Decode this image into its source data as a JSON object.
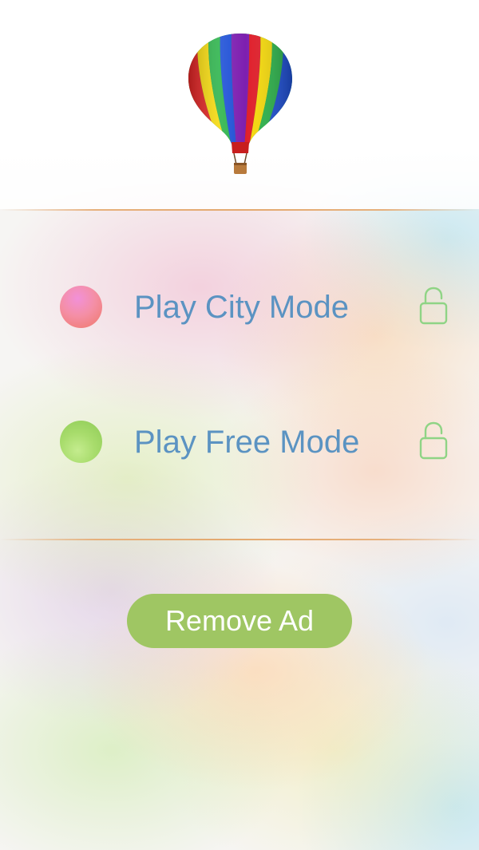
{
  "header": {
    "logo_icon": "hot-air-balloon-icon"
  },
  "modes": [
    {
      "label": "Play City Mode",
      "dot_color": "#f08a8c",
      "lock_icon": "unlocked-padlock-icon"
    },
    {
      "label": "Play Free Mode",
      "dot_color": "#a8dc6c",
      "lock_icon": "unlocked-padlock-icon"
    }
  ],
  "remove_ad": {
    "label": "Remove Ad",
    "color": "#9fc663"
  },
  "colors": {
    "label_text": "#5b93c2",
    "divider": "#e4a96f",
    "lock": "#8fd485"
  }
}
